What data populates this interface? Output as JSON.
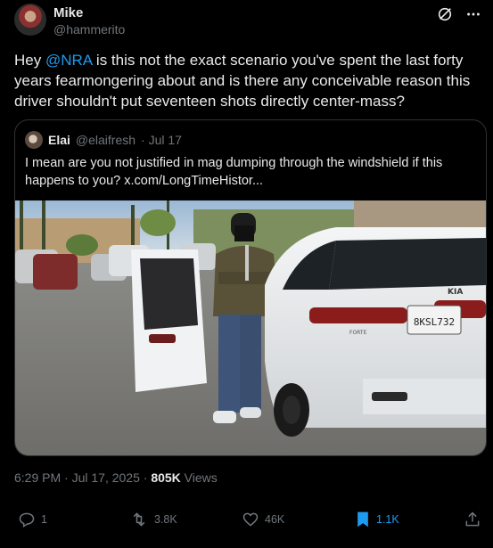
{
  "author": {
    "name": "Mike",
    "handle": "@hammerito"
  },
  "header_icons": [
    "grok-icon",
    "more-icon"
  ],
  "tweet": {
    "text_before": "Hey ",
    "mention": "@NRA",
    "text_after": " is this not the exact scenario you've spent the last forty years fearmongering about and is there any conceivable reason this driver shouldn't put seventeen shots directly center-mass?"
  },
  "quote": {
    "name": "Elai",
    "handle": "@elaifresh",
    "date": "· Jul 17",
    "text": "I mean are you not justified in mag dumping through the windshield if this happens to you?  x.com/LongTimeHistor...",
    "media": {
      "plate": "8KSL732",
      "brand": "KIA",
      "model": "FORTE"
    }
  },
  "meta": {
    "time": "6:29 PM · Jul 17, 2025 · ",
    "views_count": "805K",
    "views_label": " Views"
  },
  "actions": {
    "replies": "1",
    "retweets": "3.8K",
    "likes": "46K",
    "bookmarks": "1.1K"
  },
  "colors": {
    "accent": "#1d9bf0",
    "muted": "#71767b",
    "border": "#2f3336",
    "background": "#000000"
  }
}
